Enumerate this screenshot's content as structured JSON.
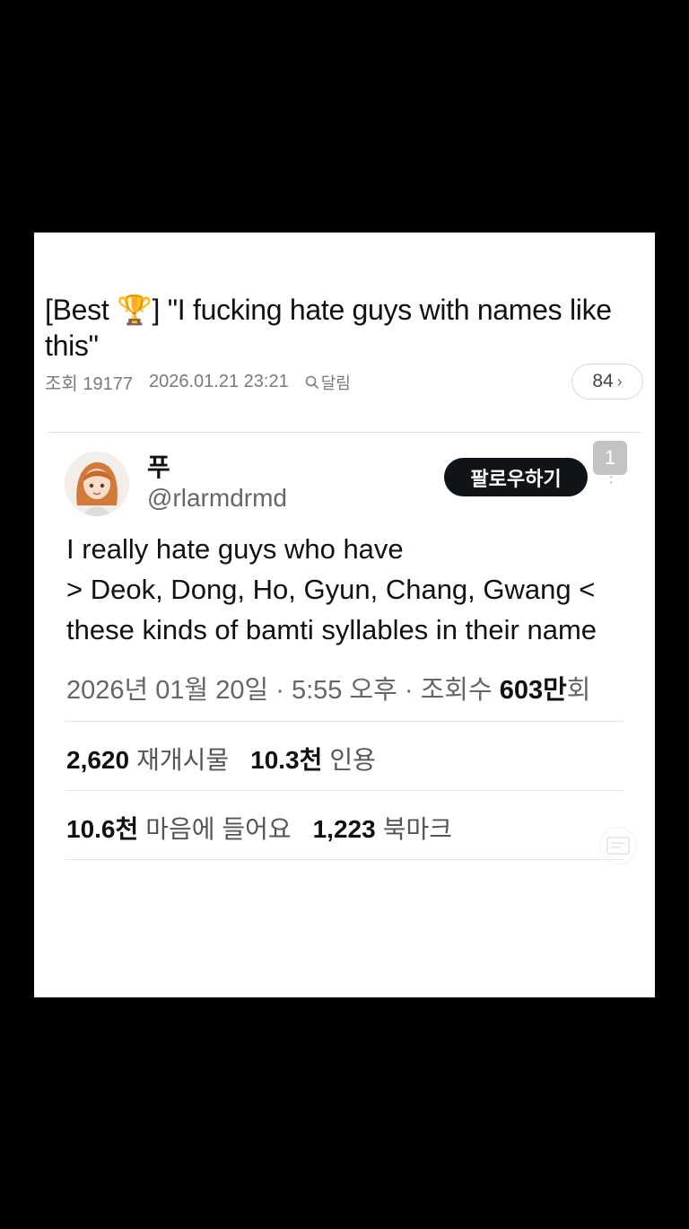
{
  "post": {
    "title": "[Best 🏆] \"I fucking hate guys with names like this\"",
    "views_label": "조회 19177",
    "datetime": "2026.01.21 23:21",
    "search_label": "달림",
    "comment_count": "84"
  },
  "tweet": {
    "display_name": "푸",
    "handle": "@rlarmdrmd",
    "follow_label": "팔로우하기",
    "badge_count": "1",
    "text_lines": [
      "I really hate guys who have",
      "> Deok, Dong, Ho, Gyun, Chang, Gwang <",
      "these kinds of bamti syllables in their name"
    ],
    "meta_prefix": "2026년 01월 20일 · 5:55 오후 · 조회수 ",
    "meta_views": "603만",
    "meta_suffix": "회",
    "stats": {
      "retweets_num": "2,620",
      "retweets_label": "재개시물",
      "quotes_num": "10.3천",
      "quotes_label": "인용",
      "likes_num": "10.6천",
      "likes_label": "마음에 들어요",
      "bookmarks_num": "1,223",
      "bookmarks_label": "북마크"
    }
  },
  "icons": {
    "search": "search-icon",
    "chevron": "chevron-right-icon",
    "more": "more-vertical-icon",
    "ghost": "article-icon"
  },
  "colors": {
    "background": "#000000",
    "card": "#ffffff",
    "follow_button": "#0f1419",
    "muted_text": "#666666"
  }
}
